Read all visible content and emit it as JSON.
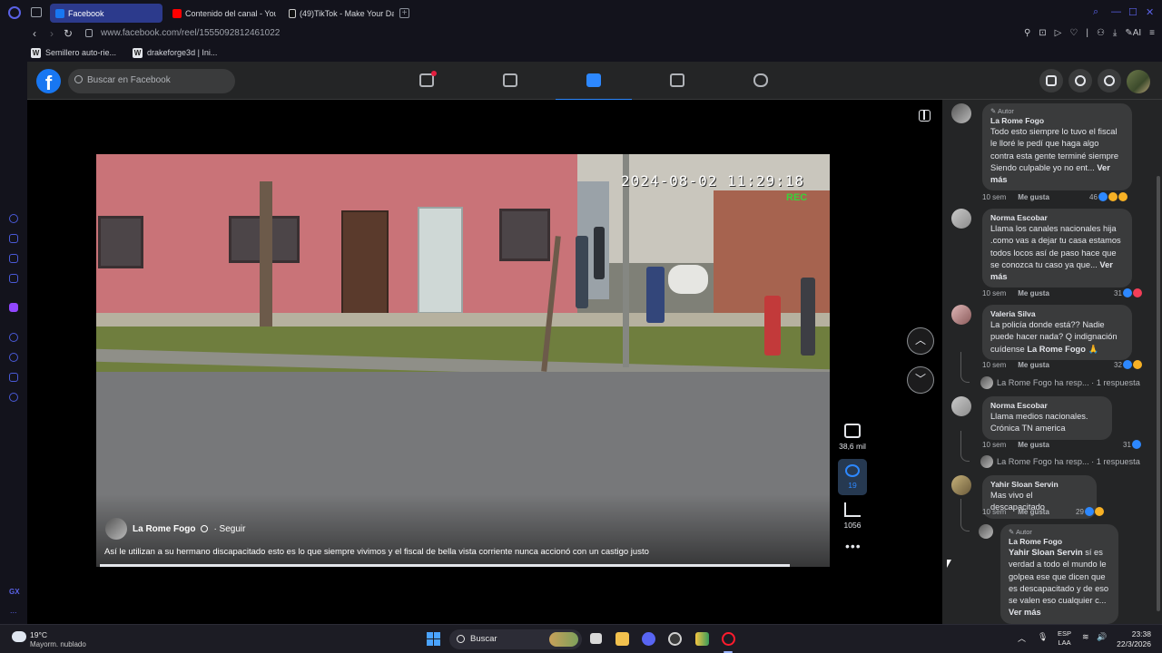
{
  "browser": {
    "tabs": [
      {
        "label": "Facebook",
        "active": true,
        "icon": "facebook-icon",
        "color": "#1877f2"
      },
      {
        "label": "Contenido del canal - You",
        "active": false,
        "icon": "youtube-icon",
        "color": "#ff0000"
      },
      {
        "label": "(49)TikTok - Make Your Da",
        "active": false,
        "icon": "tiktok-icon",
        "color": "#ffffff"
      }
    ],
    "url": "www.facebook.com/reel/1555092812461022",
    "bookmarks": [
      "Semillero auto-rie...",
      "drakeforge3d | Ini..."
    ],
    "side_label": "GX",
    "side_more": "..."
  },
  "facebook": {
    "logo": "f",
    "search_placeholder": "Buscar en Facebook",
    "accent": "#2d88ff"
  },
  "reel": {
    "timestamp": "2024-08-02 11:29:18",
    "rec_label": "REC",
    "author": "La Rome Fogo",
    "follow": "· Seguir",
    "caption": "Así le utilizan a su hermano discapacitado esto es lo que siempre vivimos y el fiscal de bella vista corriente nunca accionó con un castigo justo",
    "likes": "38,6 mil",
    "comments": "19",
    "shares": "1056",
    "more": "•••",
    "prev_icon": "chevron-up-icon",
    "next_icon": "chevron-down-icon"
  },
  "comments": [
    {
      "author_tag": "✎ Autor",
      "name": "La Rome Fogo",
      "text": "Todo esto siempre lo tuvo el fiscal le lloré le pedí que haga algo contra esta gente terminé siempre Siendo culpable yo no ent...",
      "more": " Ver más",
      "time": "10 sem",
      "like": "Me gusta",
      "reactions": "46"
    },
    {
      "name": "Norma Escobar",
      "text": "Llama los canales nacionales hija .como vas a dejar tu casa estamos todos locos así de paso hace que se conozca tu caso ya que...",
      "more": " Ver más",
      "time": "10 sem",
      "like": "Me gusta",
      "reactions": "31"
    },
    {
      "name": "Valeria Silva",
      "text": "La policía donde está?? Nadie puede hacer nada? Q indignación cuídense ",
      "mention": "La Rome Fogo",
      "emoji": " 🙏",
      "time": "10 sem",
      "like": "Me gusta",
      "reactions": "32",
      "reply": "La Rome Fogo ha resp... · 1 respuesta"
    },
    {
      "name": "Norma Escobar",
      "text": "Llama medios nacionales. Crónica TN america",
      "time": "10 sem",
      "like": "Me gusta",
      "reactions": "31",
      "reply": "La Rome Fogo ha resp... · 1 respuesta"
    },
    {
      "name": "Yahir Sloan Servin",
      "text": "Mas vivo el descapacitado",
      "time": "10 sem",
      "like": "Me gusta",
      "reactions": "29"
    },
    {
      "author_tag": "✎ Autor",
      "name": "La Rome Fogo",
      "mention": "Yahir Sloan Servin",
      "text": " sí es verdad a todo el mundo le golpea ese que dicen que es descapacitado y de eso se valen eso cualquier c...",
      "more": " Ver más"
    }
  ],
  "taskbar": {
    "temp": "19°C",
    "weather": "Mayorm. nublado",
    "search": "Buscar",
    "lang1": "ESP",
    "lang2": "LAA",
    "time": "23:38",
    "date": "22/3/2026"
  }
}
